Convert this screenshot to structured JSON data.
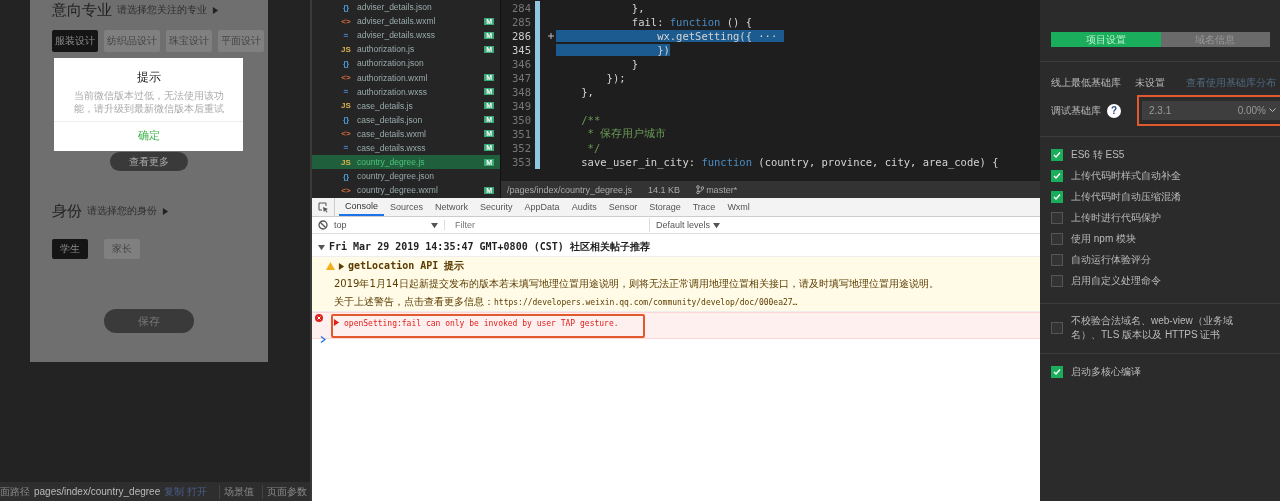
{
  "simulator": {
    "section_title": "意向专业",
    "section_hint": "请选择您关注的专业",
    "majors": [
      {
        "label": "服装设计",
        "selected": true
      },
      {
        "label": "纺织品设计",
        "selected": false
      },
      {
        "label": "珠宝设计",
        "selected": false
      },
      {
        "label": "平面设计",
        "selected": false
      }
    ],
    "more_button": "查看更多",
    "identity_title": "身份",
    "identity_hint": "请选择您的身份",
    "identities": [
      {
        "label": "学生",
        "selected": true
      },
      {
        "label": "家长",
        "selected": false
      }
    ],
    "save_button": "保存",
    "dialog": {
      "title": "提示",
      "message": "当前微信版本过低，无法使用该功能，请升级到最新微信版本后重试",
      "confirm": "确定"
    }
  },
  "simulator_status_bar": {
    "path_label": "面路径",
    "path": "pages/index/country_degree",
    "path_links": "复制 打开",
    "scene": "场景值",
    "params": "页面参数"
  },
  "file_tree": [
    {
      "kind": "json",
      "icon": "{}",
      "name": "adviser_details.json",
      "selected": false
    },
    {
      "kind": "wxml",
      "icon": "<>",
      "name": "adviser_details.wxml",
      "badge": "M",
      "selected": false
    },
    {
      "kind": "wxss",
      "icon": "≈",
      "name": "adviser_details.wxss",
      "badge": "M",
      "selected": false
    },
    {
      "kind": "js",
      "icon": "JS",
      "name": "authorization.js",
      "badge": "M",
      "selected": false
    },
    {
      "kind": "json",
      "icon": "{}",
      "name": "authorization.json",
      "selected": false
    },
    {
      "kind": "wxml",
      "icon": "<>",
      "name": "authorization.wxml",
      "badge": "M",
      "selected": false
    },
    {
      "kind": "wxss",
      "icon": "≈",
      "name": "authorization.wxss",
      "badge": "M",
      "selected": false
    },
    {
      "kind": "js",
      "icon": "JS",
      "name": "case_details.js",
      "badge": "M",
      "selected": false
    },
    {
      "kind": "json",
      "icon": "{}",
      "name": "case_details.json",
      "badge": "M",
      "selected": false
    },
    {
      "kind": "wxml",
      "icon": "<>",
      "name": "case_details.wxml",
      "badge": "M",
      "selected": false
    },
    {
      "kind": "wxss",
      "icon": "≈",
      "name": "case_details.wxss",
      "badge": "M",
      "selected": false
    },
    {
      "kind": "js",
      "icon": "JS",
      "name": "country_degree.js",
      "badge": "M",
      "selected": true
    },
    {
      "kind": "json",
      "icon": "{}",
      "name": "country_degree.json",
      "selected": false
    },
    {
      "kind": "wxml",
      "icon": "<>",
      "name": "country_degree.wxml",
      "badge": "M",
      "selected": false
    }
  ],
  "editor": {
    "lines": [
      {
        "number": "284",
        "selected": false,
        "tokens": [
          {
            "kind": "plain",
            "text": "            },"
          }
        ]
      },
      {
        "number": "285",
        "selected": false,
        "tokens": [
          {
            "kind": "plain",
            "text": "            fail: "
          },
          {
            "kind": "keyword",
            "text": "function"
          },
          {
            "kind": "plain",
            "text": " () {"
          }
        ]
      },
      {
        "number": "286",
        "folded": true,
        "selected": true,
        "tokens": [
          {
            "kind": "plain",
            "text": "                wx.getSetting({ ··· "
          }
        ]
      },
      {
        "number": "345",
        "selected": true,
        "tokens": [
          {
            "kind": "plain",
            "text": "                })"
          }
        ]
      },
      {
        "number": "346",
        "selected": false,
        "tokens": [
          {
            "kind": "plain",
            "text": "            }"
          }
        ]
      },
      {
        "number": "347",
        "selected": false,
        "tokens": [
          {
            "kind": "plain",
            "text": "        });"
          }
        ]
      },
      {
        "number": "348",
        "selected": false,
        "tokens": [
          {
            "kind": "plain",
            "text": "    },"
          }
        ]
      },
      {
        "number": "349",
        "selected": false
      },
      {
        "number": "350",
        "selected": false,
        "tokens": [
          {
            "kind": "comment",
            "text": "    /**"
          }
        ]
      },
      {
        "number": "351",
        "selected": false,
        "tokens": [
          {
            "kind": "comment",
            "text": "     * 保存用户城市"
          }
        ]
      },
      {
        "number": "352",
        "selected": false,
        "tokens": [
          {
            "kind": "comment",
            "text": "     */"
          }
        ]
      },
      {
        "number": "353",
        "selected": false,
        "tokens": [
          {
            "kind": "plain",
            "text": "    save_user_in_city: "
          },
          {
            "kind": "keyword",
            "text": "function"
          },
          {
            "kind": "plain",
            "text": " (country, province, city, area_code) {"
          }
        ]
      }
    ],
    "status_bar": {
      "path": "/pages/index/country_degree.js",
      "size": "14.1 KB",
      "branch": "master*"
    }
  },
  "console": {
    "tabs": [
      {
        "label": "Console",
        "selected": true
      },
      {
        "label": "Sources",
        "selected": false
      },
      {
        "label": "Network",
        "selected": false
      },
      {
        "label": "Security",
        "selected": false
      },
      {
        "label": "AppData",
        "selected": false
      },
      {
        "label": "Audits",
        "selected": false
      },
      {
        "label": "Sensor",
        "selected": false
      },
      {
        "label": "Storage",
        "selected": false
      },
      {
        "label": "Trace",
        "selected": false
      },
      {
        "label": "Wxml",
        "selected": false
      }
    ],
    "context": "top",
    "filter_placeholder": "Filter",
    "levels": "Default levels",
    "entries": [
      {
        "kind": "group",
        "text": "Fri Mar 29 2019 14:35:47 GMT+0800 (CST) 社区相关帖子推荐",
        "expanded": true
      },
      {
        "kind": "warning",
        "title": "getLocation API 提示",
        "message": "2019年1月14日起新提交发布的版本若未填写地理位置用途说明，则将无法正常调用地理位置相关接口，请及时填写地理位置用途说明。",
        "link_prefix": "关于上述警告，点击查看更多信息：",
        "link": "https://developers.weixin.qq.com/community/develop/doc/000ea27…"
      },
      {
        "kind": "error",
        "text": "openSetting:fail can only be invoked by user TAP gesture."
      }
    ]
  },
  "settings": {
    "tabs": [
      {
        "label": "项目设置",
        "selected": true
      },
      {
        "label": "域名信息",
        "selected": false
      }
    ],
    "min_lib_label": "线上最低基础库",
    "min_lib_value": "未设置",
    "min_lib_link": "查看使用基础库分布",
    "debug_lib_label": "调试基础库",
    "help": "?",
    "debug_lib_version": "2.3.1",
    "debug_lib_share": "0.00%",
    "options": [
      {
        "label": "ES6 转 ES5",
        "checked": true
      },
      {
        "label": "上传代码时样式自动补全",
        "checked": true
      },
      {
        "label": "上传代码时自动压缩混淆",
        "checked": true
      },
      {
        "label": "上传时进行代码保护",
        "checked": false
      },
      {
        "label": "使用 npm 模块",
        "checked": false
      },
      {
        "label": "自动运行体验评分",
        "checked": false
      },
      {
        "label": "启用自定义处理命令",
        "checked": false
      }
    ],
    "domain_options": [
      {
        "label": "不校验合法域名、web-view（业务域名）、TLS 版本以及 HTTPS 证书",
        "checked": false
      }
    ],
    "compile_options": [
      {
        "label": "启动多核心编译",
        "checked": true
      }
    ]
  }
}
